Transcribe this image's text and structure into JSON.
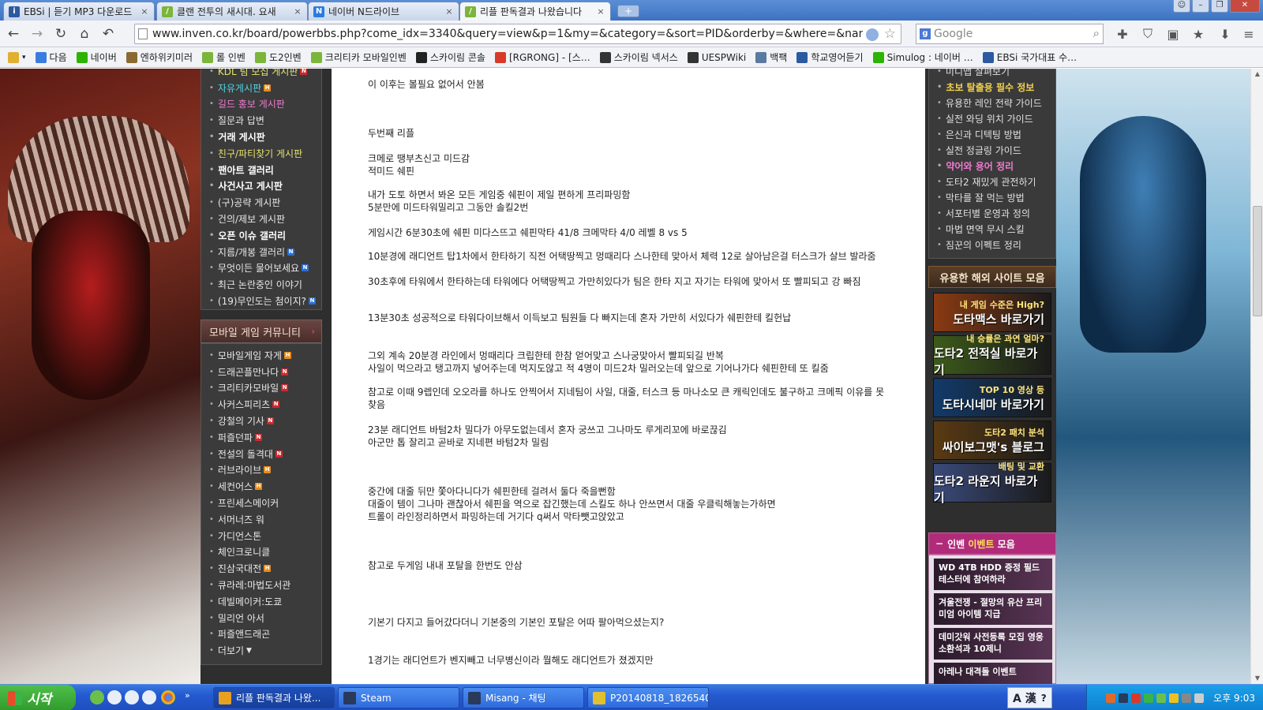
{
  "browser": {
    "tabs": [
      {
        "title": "EBSi | 듣기 MP3 다운로드",
        "icon": "ebsi-icon",
        "color": "#2c5aa0",
        "glyph": "i"
      },
      {
        "title": "클랜 전투의 새시대. 요새",
        "icon": "inven-feather-icon",
        "color": "#7bb53a",
        "glyph": "/"
      },
      {
        "title": "네이버 N드라이브",
        "icon": "naver-icon",
        "color": "#2a7be0",
        "glyph": "N"
      },
      {
        "title": "리플 판독결과 나왔습니다",
        "icon": "inven-feather-icon",
        "color": "#7bb53a",
        "glyph": "/",
        "active": true
      }
    ],
    "url": "www.inven.co.kr/board/powerbbs.php?come_idx=3340&query=view&p=1&my=&category=&sort=PID&orderby=&where=&name=subject&subje",
    "search_placeholder": "Google",
    "bookmarks": [
      {
        "label": "",
        "color": "#e0b030"
      },
      {
        "label": "다음",
        "color": "#3a7be0"
      },
      {
        "label": "네이버",
        "color": "#2db400"
      },
      {
        "label": "엔하위키미러",
        "color": "#8a6a30"
      },
      {
        "label": "롤 인벤",
        "color": "#7bb53a"
      },
      {
        "label": "도2인벤",
        "color": "#7bb53a"
      },
      {
        "label": "크리티카 모바일인벤",
        "color": "#7bb53a"
      },
      {
        "label": "스카이림 콘솔",
        "color": "#222222"
      },
      {
        "label": "[RGRONG] - [스…",
        "color": "#d83a2a"
      },
      {
        "label": "스카이림 넥서스",
        "color": "#333333"
      },
      {
        "label": "UESPWiki",
        "color": "#333333"
      },
      {
        "label": "백팩",
        "color": "#5a7aa0"
      },
      {
        "label": "학교영어듣기",
        "color": "#2c5aa0"
      },
      {
        "label": "Simulog : 네이버 …",
        "color": "#2db400"
      },
      {
        "label": "EBSi 국가대표 수…",
        "color": "#2c5aa0"
      }
    ]
  },
  "left_menu": {
    "board_items": [
      {
        "label": "KDL 팀 모집 게시판",
        "style": "yellow",
        "badge": "R"
      },
      {
        "label": "자유게시판",
        "style": "cyan",
        "badge": "H"
      },
      {
        "label": "길드 홍보 게시판",
        "style": "pink",
        "badge": ""
      },
      {
        "label": "질문과 답변",
        "style": "",
        "badge": ""
      },
      {
        "label": "거래 게시판",
        "style": "bold",
        "badge": ""
      },
      {
        "label": "친구/파티찾기 게시판",
        "style": "yellow",
        "badge": ""
      },
      {
        "label": "팬아트 갤러리",
        "style": "bold",
        "badge": ""
      },
      {
        "label": "사건사고 게시판",
        "style": "bold",
        "badge": ""
      },
      {
        "label": "(구)공략 게시판",
        "style": "",
        "badge": ""
      },
      {
        "label": "건의/제보 게시판",
        "style": "",
        "badge": ""
      },
      {
        "label": "오픈 이슈 갤러리",
        "style": "bold",
        "badge": ""
      },
      {
        "label": "지름/개봉 갤러리",
        "style": "",
        "badge": "N"
      },
      {
        "label": "무엇이든 물어보세요",
        "style": "",
        "badge": "N"
      },
      {
        "label": "최근 논란중인 이야기",
        "style": "",
        "badge": ""
      },
      {
        "label": "(19)무인도는 첨이지?",
        "style": "",
        "badge": "N"
      }
    ],
    "mobile_title": "모바일 게임 커뮤니티",
    "mobile_items": [
      {
        "label": "모바일게임 자게",
        "badge": "H"
      },
      {
        "label": "드래곤플만나다",
        "badge": "R"
      },
      {
        "label": "크리티카모바일",
        "badge": "R"
      },
      {
        "label": "사커스피리츠",
        "badge": "R"
      },
      {
        "label": "강철의 기사",
        "badge": "R"
      },
      {
        "label": "퍼즐던파",
        "badge": "R"
      },
      {
        "label": "전설의 돌격대",
        "badge": "R"
      },
      {
        "label": "러브라이브",
        "badge": "H"
      },
      {
        "label": "세컨어스",
        "badge": "H"
      },
      {
        "label": "프린세스메이커",
        "badge": ""
      },
      {
        "label": "서머너즈 워",
        "badge": ""
      },
      {
        "label": "가디언스톤",
        "badge": ""
      },
      {
        "label": "체인크로니클",
        "badge": ""
      },
      {
        "label": "진삼국대전",
        "badge": "H"
      },
      {
        "label": "큐라레:마법도서관",
        "badge": ""
      },
      {
        "label": "데빌메이커:도쿄",
        "badge": ""
      },
      {
        "label": "밀리언 아서",
        "badge": ""
      },
      {
        "label": "퍼즐앤드래곤",
        "badge": ""
      },
      {
        "label": "더보기",
        "badge": "",
        "more": true
      }
    ]
  },
  "post": {
    "lines": [
      "이 이후는 볼필요 없어서 안봄",
      "두번째 리플",
      "크메로 땡부츠신고 미드감",
      "적미드 쉐핀",
      "내가 도토 하면서 봐온 모든 게임중 쉐핀이 제일 편하게 프리파밍함",
      "5분만에 미드타워밀리고 그동안 솔킬2번",
      "게임시간 6분30초에 쉐핀 미다스뜨고 쉐핀막타 41/8  크메막타 4/0   레벨 8 vs 5",
      "10분경에 래디언트 탑1차에서 한타하기 직전 어택땅찍고 멍때리다 스나한테 맞아서 체력 12로 살아남은걸 터스크가 살브 발라줌",
      "30초후에 타워에서 한타하는데 타워에다 어택땅찍고 가만히있다가 팀은 한타 지고 자기는 타워에 맞아서 또 빨피되고 강 빠짐",
      "13분30초 성공적으로 타워다이브해서 이득보고 팀원들 다 빠지는데 혼자 가만히 서있다가 쉐핀한테 킬헌납",
      "그외 계속 20분경 라인에서 멍때리다 크립한테 한참 얻어맞고 스나궁맞아서 빨피되길 반복",
      "사일이 먹으라고 탱고까지 넣어주는데 먹지도않고 적 4명이 미드2차 밀러오는데 앞으로 기어나가다 쉐핀한테 또 킬줌",
      "참고로 이때 9렙인데 오오라를 하나도 안찍어서 지네팀이 사일, 대줄, 터스크 등 마나소모 큰 캐릭인데도 불구하고 크메픽 이유를 못찾음",
      "23분 래디언트 바텀2차 밀다가 아무도없는데서 혼자 궁쓰고 그나마도 루게리꼬에 바로끊김",
      "아군만 톱 잘리고 곧바로 지네편 바텀2차 밀림",
      "중간에 대줄 뒤만 쫓아다니다가 쉐핀한테 걸려서 둘다 죽을뻔함",
      "대줄이 템이 그나마 괜찮아서 쉐핀을 역으로 잡긴했는데 스킬도 하나 안쓰면서 대줄 우클릭해놓는가하면",
      "트롤이 라인정리하면서 파밍하는데 거기다 q써서 막타뺏고앉았고",
      "참고로 두게임 내내 포탈을 한번도 안삼",
      "기본기 다지고 들어갔다더니 기본중의 기본인 포탈은 어따 팔아먹으셨는지?",
      "1경기는 래디언트가 벤지빼고 너무병신이라 뭘해도 래디언트가 졌겠지만"
    ]
  },
  "right_col": {
    "guide_items": [
      {
        "label": "미니맵 살펴보기",
        "style": ""
      },
      {
        "label": "초보 탈출용 필수 정보",
        "style": "yellow"
      },
      {
        "label": "유용한 레인 전략 가이드",
        "style": ""
      },
      {
        "label": "실전 와딩 위치 가이드",
        "style": ""
      },
      {
        "label": "은신과 디텍팅 방법",
        "style": ""
      },
      {
        "label": "실전 정글링 가이드",
        "style": ""
      },
      {
        "label": "약어와 용어 정리",
        "style": "pink"
      },
      {
        "label": "도타2 재밌게 관전하기",
        "style": ""
      },
      {
        "label": "막타를 잘 먹는 방법",
        "style": ""
      },
      {
        "label": "서포터별 운영과 정의",
        "style": ""
      },
      {
        "label": "마법 면역 무시 스킬",
        "style": ""
      },
      {
        "label": "짐꾼의 이펙트 정리",
        "style": ""
      }
    ],
    "sites_title": "유용한 해외 사이트 모음",
    "banners": [
      {
        "small": "내 게임 수준은 High?",
        "big": "도타맥스 바로가기",
        "color": "#8a3a12"
      },
      {
        "small": "내 승률은 과연 얼마?",
        "big": "도타2 전적실 바로가기",
        "color": "#3d5a1a"
      },
      {
        "small": "TOP 10 영상 등",
        "big": "도타시네마 바로가기",
        "color": "#123a6a"
      },
      {
        "small": "도타2 패치 분석",
        "big": "싸이보그맷's 블로그",
        "color": "#5a3a12"
      },
      {
        "small": "배팅 및 교환",
        "big": "도타2 라운지 바로가기",
        "color": "#3a4a7a"
      }
    ],
    "events_title_prefix": "인벤",
    "events_title_highlight": "이벤트",
    "events_title_suffix": "모음",
    "events": [
      "WD 4TB HDD 증정 필드테스터에 참여하라",
      "겨울전쟁 - 절망의 유산 프리미엄 아이템 지급",
      "데미갓워 사전등록 모집 영웅 소환석과 10제니",
      "아레나 대격돌 이벤트"
    ]
  },
  "taskbar": {
    "start_label": "시작",
    "tasks": [
      {
        "label": "리플 판독결과 나왔...",
        "active": true,
        "color": "#e8a020"
      },
      {
        "label": "Steam",
        "active": false,
        "color": "#2a3a5a"
      },
      {
        "label": "Misang - 채팅",
        "active": false,
        "color": "#2a3a5a"
      },
      {
        "label": "P20140818_1826540...",
        "active": false,
        "color": "#e0c030"
      }
    ],
    "ime": "A 漢",
    "clock": "오후 9:03"
  }
}
